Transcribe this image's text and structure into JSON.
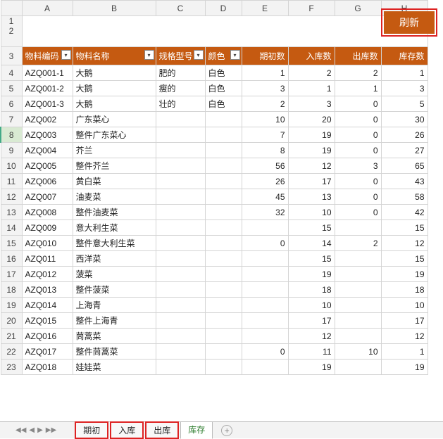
{
  "columns": [
    "A",
    "B",
    "C",
    "D",
    "E",
    "F",
    "G",
    "H"
  ],
  "refresh_label": "刷新",
  "headers": [
    "物料编码",
    "物料名称",
    "规格型号",
    "颜色",
    "期初数",
    "入库数",
    "出库数",
    "库存数"
  ],
  "selected_row": 8,
  "rows": [
    {
      "n": 4,
      "code": "AZQ001-1",
      "name": "大鹅",
      "spec": "肥的",
      "color": "白色",
      "qichu": "1",
      "ruku": "2",
      "chuku": "2",
      "kucun": "1"
    },
    {
      "n": 5,
      "code": "AZQ001-2",
      "name": "大鹅",
      "spec": "瘦的",
      "color": "白色",
      "qichu": "3",
      "ruku": "1",
      "chuku": "1",
      "kucun": "3"
    },
    {
      "n": 6,
      "code": "AZQ001-3",
      "name": "大鹅",
      "spec": "壮的",
      "color": "白色",
      "qichu": "2",
      "ruku": "3",
      "chuku": "0",
      "kucun": "5"
    },
    {
      "n": 7,
      "code": "AZQ002",
      "name": "广东菜心",
      "spec": "",
      "color": "",
      "qichu": "10",
      "ruku": "20",
      "chuku": "0",
      "kucun": "30"
    },
    {
      "n": 8,
      "code": "AZQ003",
      "name": "整件广东菜心",
      "spec": "",
      "color": "",
      "qichu": "7",
      "ruku": "19",
      "chuku": "0",
      "kucun": "26"
    },
    {
      "n": 9,
      "code": "AZQ004",
      "name": "芥兰",
      "spec": "",
      "color": "",
      "qichu": "8",
      "ruku": "19",
      "chuku": "0",
      "kucun": "27"
    },
    {
      "n": 10,
      "code": "AZQ005",
      "name": "整件芥兰",
      "spec": "",
      "color": "",
      "qichu": "56",
      "ruku": "12",
      "chuku": "3",
      "kucun": "65"
    },
    {
      "n": 11,
      "code": "AZQ006",
      "name": "黄白菜",
      "spec": "",
      "color": "",
      "qichu": "26",
      "ruku": "17",
      "chuku": "0",
      "kucun": "43"
    },
    {
      "n": 12,
      "code": "AZQ007",
      "name": "油麦菜",
      "spec": "",
      "color": "",
      "qichu": "45",
      "ruku": "13",
      "chuku": "0",
      "kucun": "58"
    },
    {
      "n": 13,
      "code": "AZQ008",
      "name": "整件油麦菜",
      "spec": "",
      "color": "",
      "qichu": "32",
      "ruku": "10",
      "chuku": "0",
      "kucun": "42"
    },
    {
      "n": 14,
      "code": "AZQ009",
      "name": "意大利生菜",
      "spec": "",
      "color": "",
      "qichu": "",
      "ruku": "15",
      "chuku": "",
      "kucun": "15"
    },
    {
      "n": 15,
      "code": "AZQ010",
      "name": "整件意大利生菜",
      "spec": "",
      "color": "",
      "qichu": "0",
      "ruku": "14",
      "chuku": "2",
      "kucun": "12"
    },
    {
      "n": 16,
      "code": "AZQ011",
      "name": "西洋菜",
      "spec": "",
      "color": "",
      "qichu": "",
      "ruku": "15",
      "chuku": "",
      "kucun": "15"
    },
    {
      "n": 17,
      "code": "AZQ012",
      "name": "菠菜",
      "spec": "",
      "color": "",
      "qichu": "",
      "ruku": "19",
      "chuku": "",
      "kucun": "19"
    },
    {
      "n": 18,
      "code": "AZQ013",
      "name": "整件菠菜",
      "spec": "",
      "color": "",
      "qichu": "",
      "ruku": "18",
      "chuku": "",
      "kucun": "18"
    },
    {
      "n": 19,
      "code": "AZQ014",
      "name": "上海青",
      "spec": "",
      "color": "",
      "qichu": "",
      "ruku": "10",
      "chuku": "",
      "kucun": "10"
    },
    {
      "n": 20,
      "code": "AZQ015",
      "name": "整件上海青",
      "spec": "",
      "color": "",
      "qichu": "",
      "ruku": "17",
      "chuku": "",
      "kucun": "17"
    },
    {
      "n": 21,
      "code": "AZQ016",
      "name": "茼蒿菜",
      "spec": "",
      "color": "",
      "qichu": "",
      "ruku": "12",
      "chuku": "",
      "kucun": "12"
    },
    {
      "n": 22,
      "code": "AZQ017",
      "name": "整件茼蒿菜",
      "spec": "",
      "color": "",
      "qichu": "0",
      "ruku": "11",
      "chuku": "10",
      "kucun": "1"
    },
    {
      "n": 23,
      "code": "AZQ018",
      "name": "娃娃菜",
      "spec": "",
      "color": "",
      "qichu": "",
      "ruku": "19",
      "chuku": "",
      "kucun": "19"
    }
  ],
  "tabs": [
    {
      "label": "期初",
      "boxed": true
    },
    {
      "label": "入库",
      "boxed": true
    },
    {
      "label": "出库",
      "boxed": true
    },
    {
      "label": "库存",
      "boxed": false,
      "active": true
    }
  ],
  "chart_data": {
    "type": "table",
    "columns": [
      "物料编码",
      "物料名称",
      "规格型号",
      "颜色",
      "期初数",
      "入库数",
      "出库数",
      "库存数"
    ],
    "data": [
      [
        "AZQ001-1",
        "大鹅",
        "肥的",
        "白色",
        1,
        2,
        2,
        1
      ],
      [
        "AZQ001-2",
        "大鹅",
        "瘦的",
        "白色",
        3,
        1,
        1,
        3
      ],
      [
        "AZQ001-3",
        "大鹅",
        "壮的",
        "白色",
        2,
        3,
        0,
        5
      ],
      [
        "AZQ002",
        "广东菜心",
        "",
        "",
        10,
        20,
        0,
        30
      ],
      [
        "AZQ003",
        "整件广东菜心",
        "",
        "",
        7,
        19,
        0,
        26
      ],
      [
        "AZQ004",
        "芥兰",
        "",
        "",
        8,
        19,
        0,
        27
      ],
      [
        "AZQ005",
        "整件芥兰",
        "",
        "",
        56,
        12,
        3,
        65
      ],
      [
        "AZQ006",
        "黄白菜",
        "",
        "",
        26,
        17,
        0,
        43
      ],
      [
        "AZQ007",
        "油麦菜",
        "",
        "",
        45,
        13,
        0,
        58
      ],
      [
        "AZQ008",
        "整件油麦菜",
        "",
        "",
        32,
        10,
        0,
        42
      ],
      [
        "AZQ009",
        "意大利生菜",
        "",
        "",
        null,
        15,
        null,
        15
      ],
      [
        "AZQ010",
        "整件意大利生菜",
        "",
        "",
        0,
        14,
        2,
        12
      ],
      [
        "AZQ011",
        "西洋菜",
        "",
        "",
        null,
        15,
        null,
        15
      ],
      [
        "AZQ012",
        "菠菜",
        "",
        "",
        null,
        19,
        null,
        19
      ],
      [
        "AZQ013",
        "整件菠菜",
        "",
        "",
        null,
        18,
        null,
        18
      ],
      [
        "AZQ014",
        "上海青",
        "",
        "",
        null,
        10,
        null,
        10
      ],
      [
        "AZQ015",
        "整件上海青",
        "",
        "",
        null,
        17,
        null,
        17
      ],
      [
        "AZQ016",
        "茼蒿菜",
        "",
        "",
        null,
        12,
        null,
        12
      ],
      [
        "AZQ017",
        "整件茼蒿菜",
        "",
        "",
        0,
        11,
        10,
        1
      ],
      [
        "AZQ018",
        "娃娃菜",
        "",
        "",
        null,
        19,
        null,
        19
      ]
    ]
  }
}
